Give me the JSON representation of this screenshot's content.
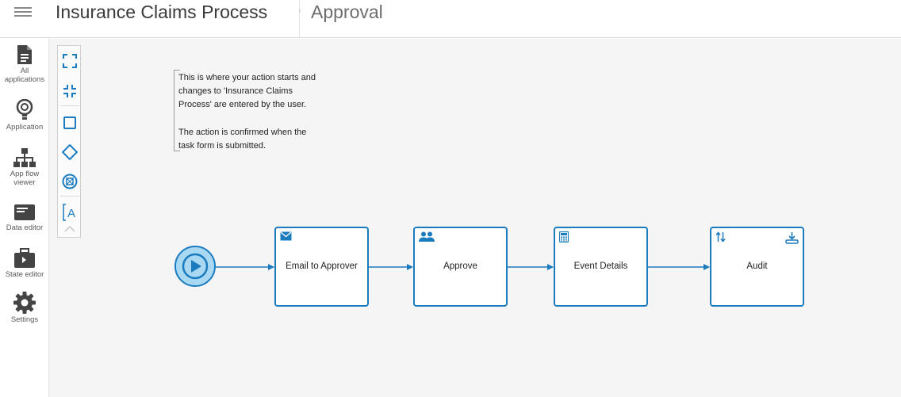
{
  "header": {
    "app_title": "Insurance Claims Process",
    "page_title": "Approval"
  },
  "sidebar": {
    "items": [
      {
        "label_line1": "All",
        "label_line2": "applications",
        "icon": "document-icon"
      },
      {
        "label_line1": "Application",
        "label_line2": "",
        "icon": "lightbulb-icon"
      },
      {
        "label_line1": "App flow",
        "label_line2": "viewer",
        "icon": "sitemap-icon"
      },
      {
        "label_line1": "Data editor",
        "label_line2": "",
        "icon": "data-card-icon"
      },
      {
        "label_line1": "State editor",
        "label_line2": "",
        "icon": "briefcase-icon"
      },
      {
        "label_line1": "Settings",
        "label_line2": "",
        "icon": "gear-icon"
      }
    ]
  },
  "palette": {
    "tools": [
      "expand-icon",
      "collapse-icon",
      "task-shape-icon",
      "gateway-shape-icon",
      "end-event-icon",
      "text-annotation-icon",
      "chevron-up-icon"
    ]
  },
  "annotation": {
    "line1": "This is where your action starts and",
    "line2": "changes to 'Insurance Claims",
    "line3": "Process' are entered by the user.",
    "line4": "The action is confirmed when the",
    "line5": "task form is submitted."
  },
  "flow": {
    "start_event": "play-icon",
    "tasks": [
      {
        "label": "Email to Approver",
        "icon": "envelope-icon"
      },
      {
        "label": "Approve",
        "icon": "users-icon"
      },
      {
        "label": "Event Details",
        "icon": "calculator-icon"
      },
      {
        "label": "Audit",
        "icon": "sort-arrows-icon",
        "icon_right": "download-tray-icon"
      }
    ]
  },
  "colors": {
    "accent": "#1b7bbf",
    "start_fill": "#a9d9f2",
    "canvas": "#f5f5f5"
  }
}
